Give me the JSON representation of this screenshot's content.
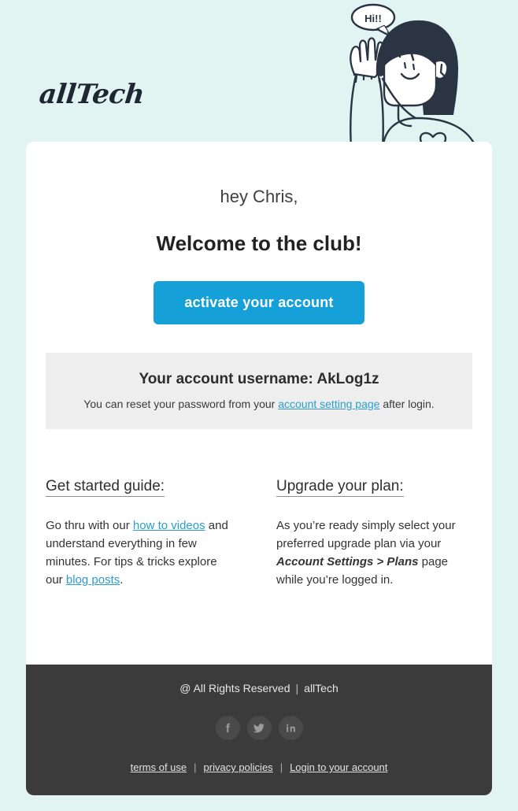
{
  "header": {
    "logo_text": "allTech",
    "illustration": {
      "name": "waving-woman-illustration",
      "speech_bubble_text": "Hi!!",
      "hair_color": "#2b3443",
      "line_color": "#2b3443"
    }
  },
  "main": {
    "greeting": "hey Chris,",
    "headline": "Welcome to the club!",
    "cta_label": "activate your account",
    "cta_color": "#15a0d7",
    "username_box": {
      "title": "Your account username: AkLog1z",
      "sub_before": "You can reset your password from your ",
      "sub_link": "account setting page",
      "sub_after": " after login.",
      "background": "#eeeeee"
    },
    "columns": [
      {
        "title": "Get started guide:",
        "text_1": "Go thru with our ",
        "link_1": "how to videos",
        "text_2": " and understand everything in few minutes. For tips & tricks explore our ",
        "link_2": "blog posts",
        "text_3": "."
      },
      {
        "title": "Upgrade your plan:",
        "text_1": "As you’re ready simply select your preferred upgrade plan via your ",
        "emphasis": "Account Settings > Plans",
        "text_2": " page while you’re logged in."
      }
    ],
    "link_color": "#2c9dc9"
  },
  "footer": {
    "background": "#3b3b3b",
    "copyright": "@ All Rights Reserved",
    "separator": "|",
    "brand": "allTech",
    "socials": [
      {
        "name": "facebook-icon",
        "label": "f"
      },
      {
        "name": "twitter-icon",
        "label": "t"
      },
      {
        "name": "linkedin-icon",
        "label": "in"
      }
    ],
    "links": [
      "terms of use",
      "privacy policies",
      "Login to your account"
    ]
  },
  "page": {
    "background": "#e2f4f2"
  }
}
